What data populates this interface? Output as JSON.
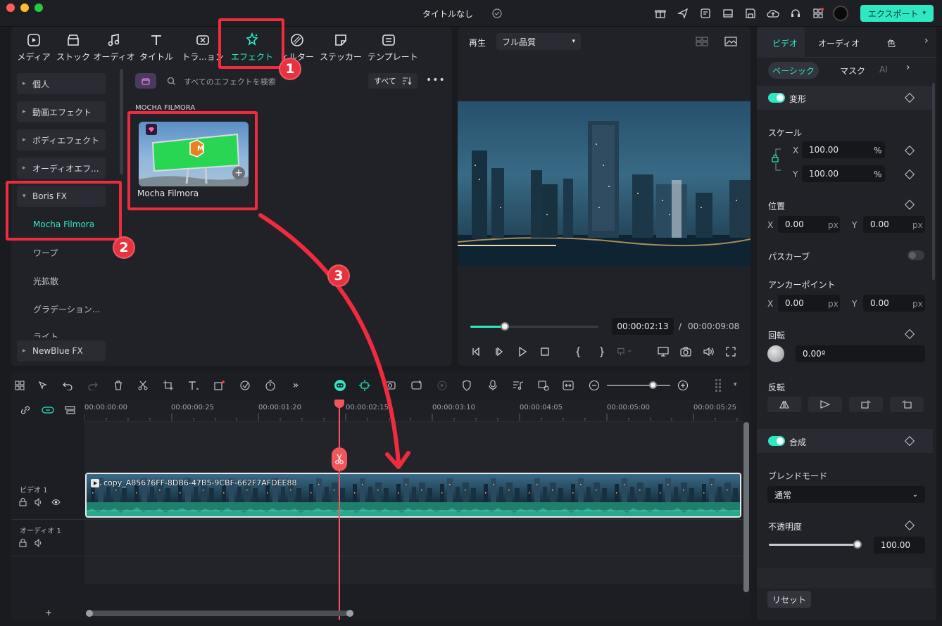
{
  "window": {
    "title": "タイトルなし",
    "export_label": "エクスポート"
  },
  "library": {
    "tabs": [
      {
        "label": "メディア",
        "icon": "media-icon"
      },
      {
        "label": "ストック",
        "icon": "stock-icon"
      },
      {
        "label": "オーディオ",
        "icon": "audio-icon"
      },
      {
        "label": "タイトル",
        "icon": "title-icon"
      },
      {
        "label": "トラ...ョン",
        "icon": "transition-icon"
      },
      {
        "label": "エフェクト",
        "icon": "effects-icon"
      },
      {
        "label": "ィルター",
        "icon": "filter-icon"
      },
      {
        "label": "ステッカー",
        "icon": "sticker-icon"
      },
      {
        "label": "テンプレート",
        "icon": "template-icon"
      }
    ],
    "categories": [
      "個人",
      "動画エフェクト",
      "ボディエフェクト",
      "オーディオエフ...",
      "Boris FX",
      "NewBlue FX"
    ],
    "sub_items": [
      "Mocha Filmora",
      "ワープ",
      "光拡散",
      "グラデーション...",
      "ライト"
    ],
    "search_placeholder": "すべてのエフェクトを検索",
    "filter_label": "すべて",
    "section_title": "MOCHA FILMORA",
    "effect_card_label": "Mocha Filmora",
    "logo_letter": "M"
  },
  "annotations": {
    "step1": "1",
    "step2": "2",
    "step3": "3"
  },
  "preview": {
    "play_label": "再生",
    "quality": "フル品質",
    "current_time": "00:00:02:13",
    "separator": "/",
    "total_time": "00:00:09:08",
    "progress": 0.27
  },
  "timeline": {
    "ruler": [
      "00:00:00:00",
      "00:00:00:25",
      "00:00:01:20",
      "00:00:02:15",
      "00:00:03:10",
      "00:00:04:05",
      "00:00:05:00",
      "00:00:05:25"
    ],
    "tracks": {
      "video": "ビデオ 1",
      "audio": "オーディオ 1"
    },
    "clip_name": "copy_A85676FF-8DB6-47B5-9CBF-662F7AFDEE88"
  },
  "inspector": {
    "tabs": [
      "ビデオ",
      "オーディオ",
      "色"
    ],
    "subtabs": [
      "ベーシック",
      "マスク",
      "AI"
    ],
    "transform_label": "変形",
    "scale_label": "スケール",
    "scale_x": "100.00",
    "scale_y": "100.00",
    "percent": "%",
    "axis_x": "X",
    "axis_y": "Y",
    "position_label": "位置",
    "pos_x": "0.00",
    "pos_y": "0.00",
    "px": "px",
    "path_curve_label": "パスカーブ",
    "anchor_label": "アンカーポイント",
    "anchor_x": "0.00",
    "anchor_y": "0.00",
    "rotate_label": "回転",
    "rotate_value": "0.00º",
    "flip_label": "反転",
    "composite_label": "合成",
    "blend_label": "ブレンドモード",
    "blend_value": "通常",
    "opacity_label": "不透明度",
    "opacity_value": "100.00",
    "reset_label": "リセット",
    "accent_color": "#2ee8c4"
  },
  "colors": {
    "accent": "#2ee8c4",
    "annotation_red": "#ef2b3d",
    "playhead": "#f0565a"
  }
}
